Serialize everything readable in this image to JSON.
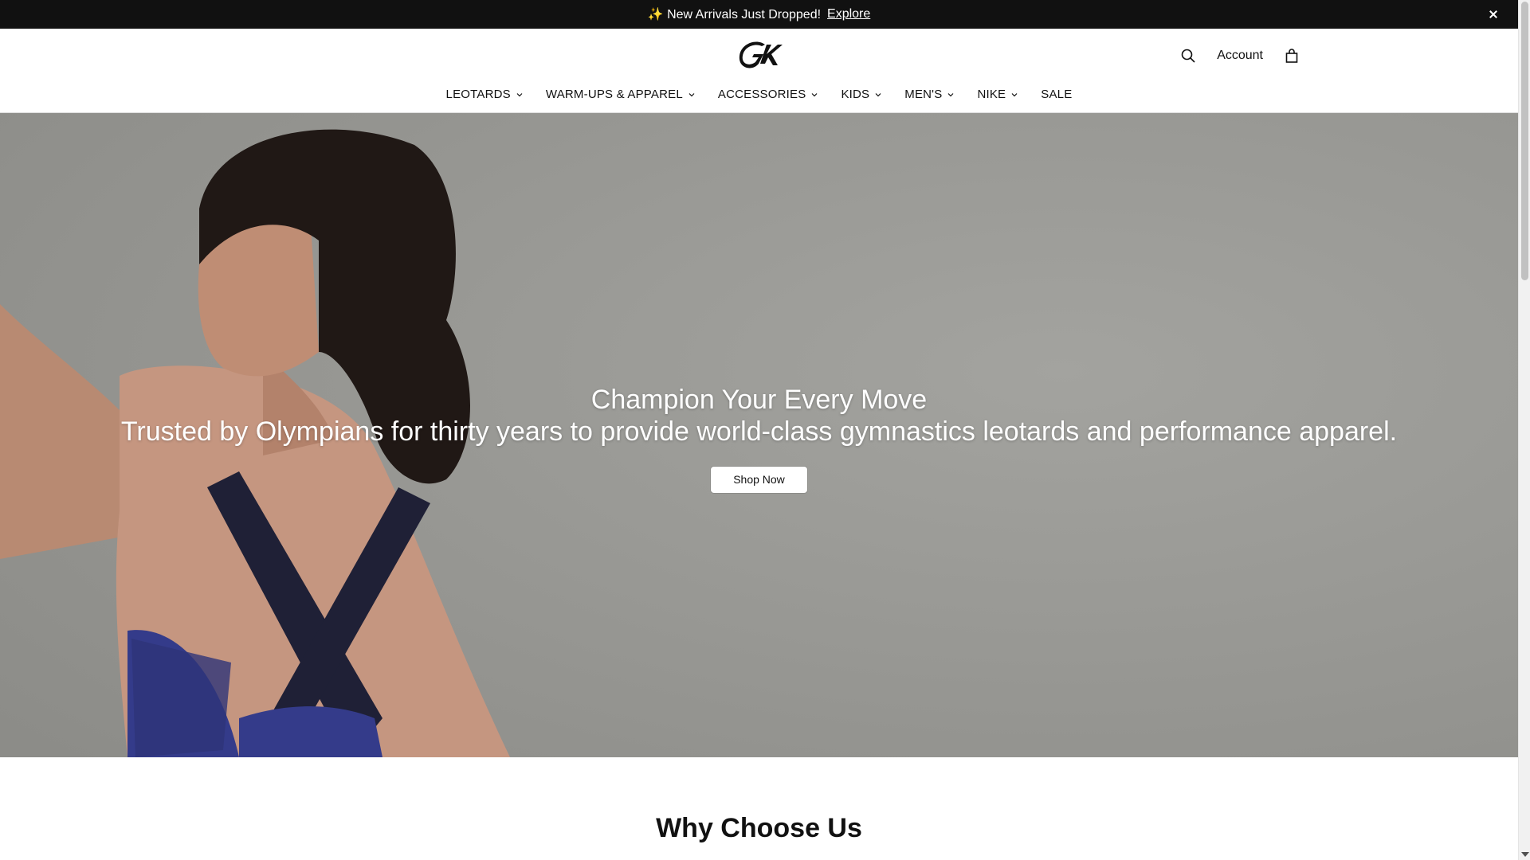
{
  "announcement": {
    "text": "✨ New Arrivals Just Dropped!",
    "link_label": "Explore"
  },
  "header": {
    "logo_icon": "gk-logo-icon",
    "account_label": "Account",
    "search_icon": "search-icon",
    "bag_icon": "shopping-bag-icon"
  },
  "nav": {
    "items": [
      {
        "label": "LEOTARDS",
        "has_dropdown": true
      },
      {
        "label": "WARM-UPS & APPAREL",
        "has_dropdown": true
      },
      {
        "label": "ACCESSORIES",
        "has_dropdown": true
      },
      {
        "label": "KIDS",
        "has_dropdown": true
      },
      {
        "label": "MEN'S",
        "has_dropdown": true
      },
      {
        "label": "NIKE",
        "has_dropdown": true
      },
      {
        "label": "SALE",
        "has_dropdown": false
      }
    ]
  },
  "hero": {
    "title": "Champion Your Every Move",
    "subtitle": "Trusted by Olympians for thirty years to provide world-class gymnastics leotards and performance apparel.",
    "cta_label": "Shop Now"
  },
  "why": {
    "heading": "Why Choose Us"
  },
  "colors": {
    "announcement_bg": "#111111",
    "hero_bg": "#9a9a96",
    "text": "#111111"
  }
}
